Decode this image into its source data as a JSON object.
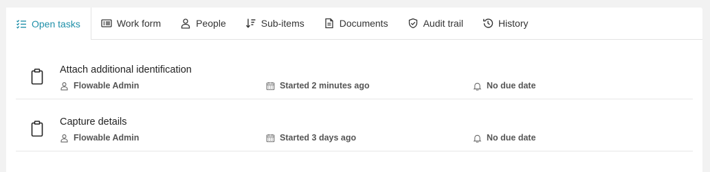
{
  "tabs": [
    {
      "label": "Open tasks",
      "icon": "checklist-icon",
      "active": true
    },
    {
      "label": "Work form",
      "icon": "form-icon",
      "active": false
    },
    {
      "label": "People",
      "icon": "person-icon",
      "active": false
    },
    {
      "label": "Sub-items",
      "icon": "sort-icon",
      "active": false
    },
    {
      "label": "Documents",
      "icon": "document-icon",
      "active": false
    },
    {
      "label": "Audit trail",
      "icon": "shield-check-icon",
      "active": false
    },
    {
      "label": "History",
      "icon": "history-icon",
      "active": false
    }
  ],
  "tasks": [
    {
      "title": "Attach additional identification",
      "assignee": "Flowable Admin",
      "started": "Started 2 minutes ago",
      "due": "No due date"
    },
    {
      "title": "Capture details",
      "assignee": "Flowable Admin",
      "started": "Started 3 days ago",
      "due": "No due date"
    }
  ],
  "colors": {
    "accent": "#1e8fa8",
    "divider": "#e3e3e3",
    "background": "#f2f2f2"
  }
}
